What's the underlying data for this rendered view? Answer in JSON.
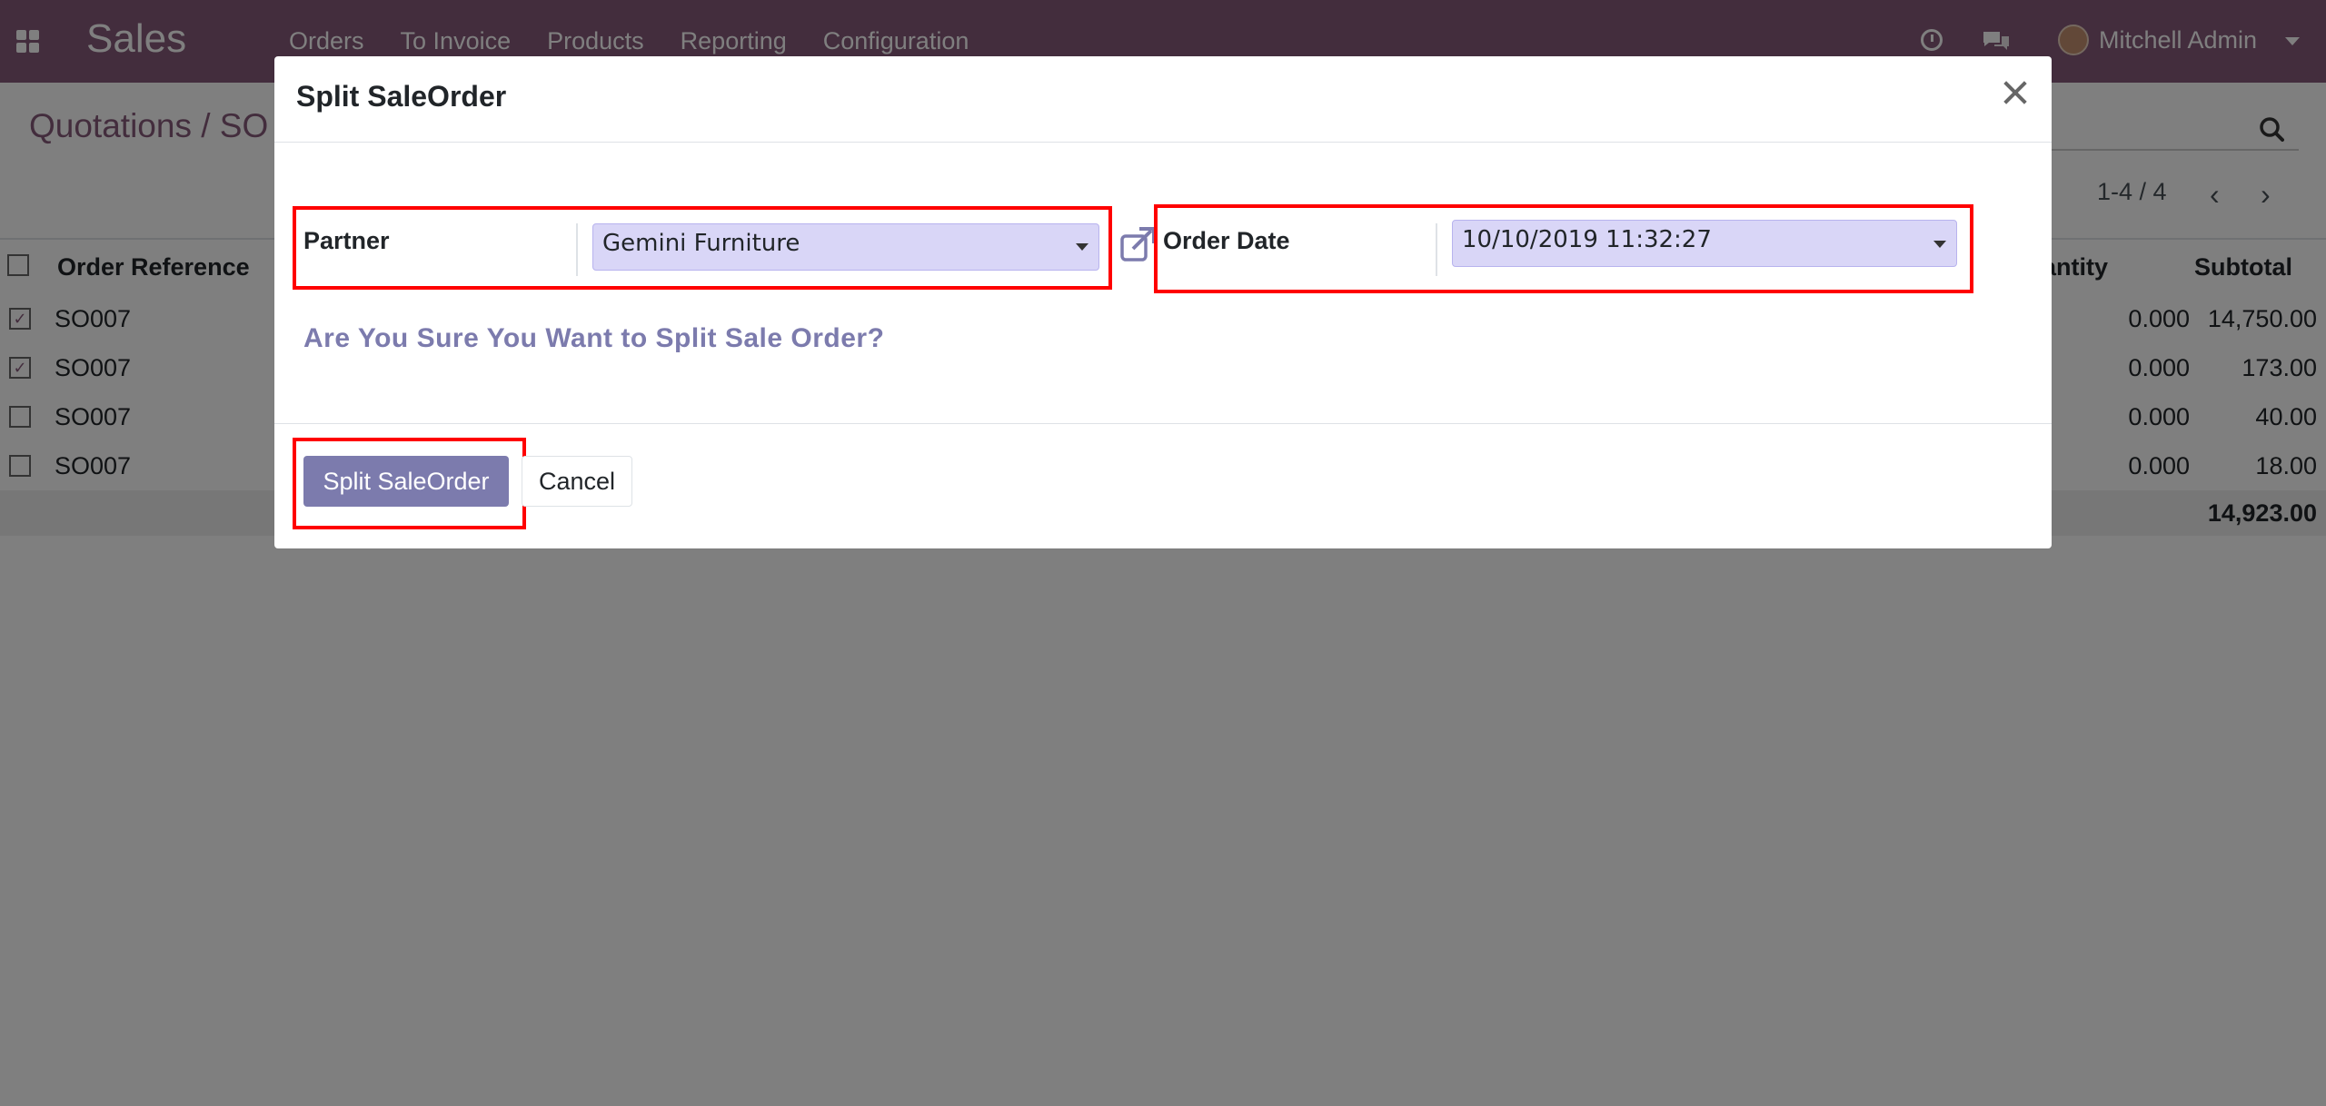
{
  "navbar": {
    "app_name": "Sales",
    "menu": [
      "Orders",
      "To Invoice",
      "Products",
      "Reporting",
      "Configuration"
    ],
    "user_name": "Mitchell Admin",
    "icons": [
      "apps-icon",
      "clock-icon",
      "chat-icon",
      "avatar",
      "chevron-down-icon"
    ]
  },
  "control_panel": {
    "breadcrumb": "Quotations / SO",
    "pager": "1-4 / 4"
  },
  "list": {
    "headers": {
      "order_reference": "Order Reference",
      "quantity": "antity",
      "subtotal": "Subtotal"
    },
    "rows": [
      {
        "checked": true,
        "ref": "SO007",
        "qty": "0.000",
        "subtotal": "14,750.00"
      },
      {
        "checked": true,
        "ref": "SO007",
        "qty": "0.000",
        "subtotal": "173.00"
      },
      {
        "checked": false,
        "ref": "SO007",
        "qty": "0.000",
        "subtotal": "40.00"
      },
      {
        "checked": false,
        "ref": "SO007",
        "qty": "0.000",
        "subtotal": "18.00"
      }
    ],
    "total": "14,923.00"
  },
  "modal": {
    "title": "Split SaleOrder",
    "partner_label": "Partner",
    "partner_value": "Gemini Furniture",
    "order_date_label": "Order Date",
    "order_date_value": "10/10/2019 11:32:27",
    "question": "Are You Sure You Want to Split Sale Order?",
    "confirm_label": "Split SaleOrder",
    "cancel_label": "Cancel"
  },
  "colors": {
    "brand": "#875a7b",
    "primary_button": "#7c7bad",
    "highlight": "#ff0000"
  }
}
